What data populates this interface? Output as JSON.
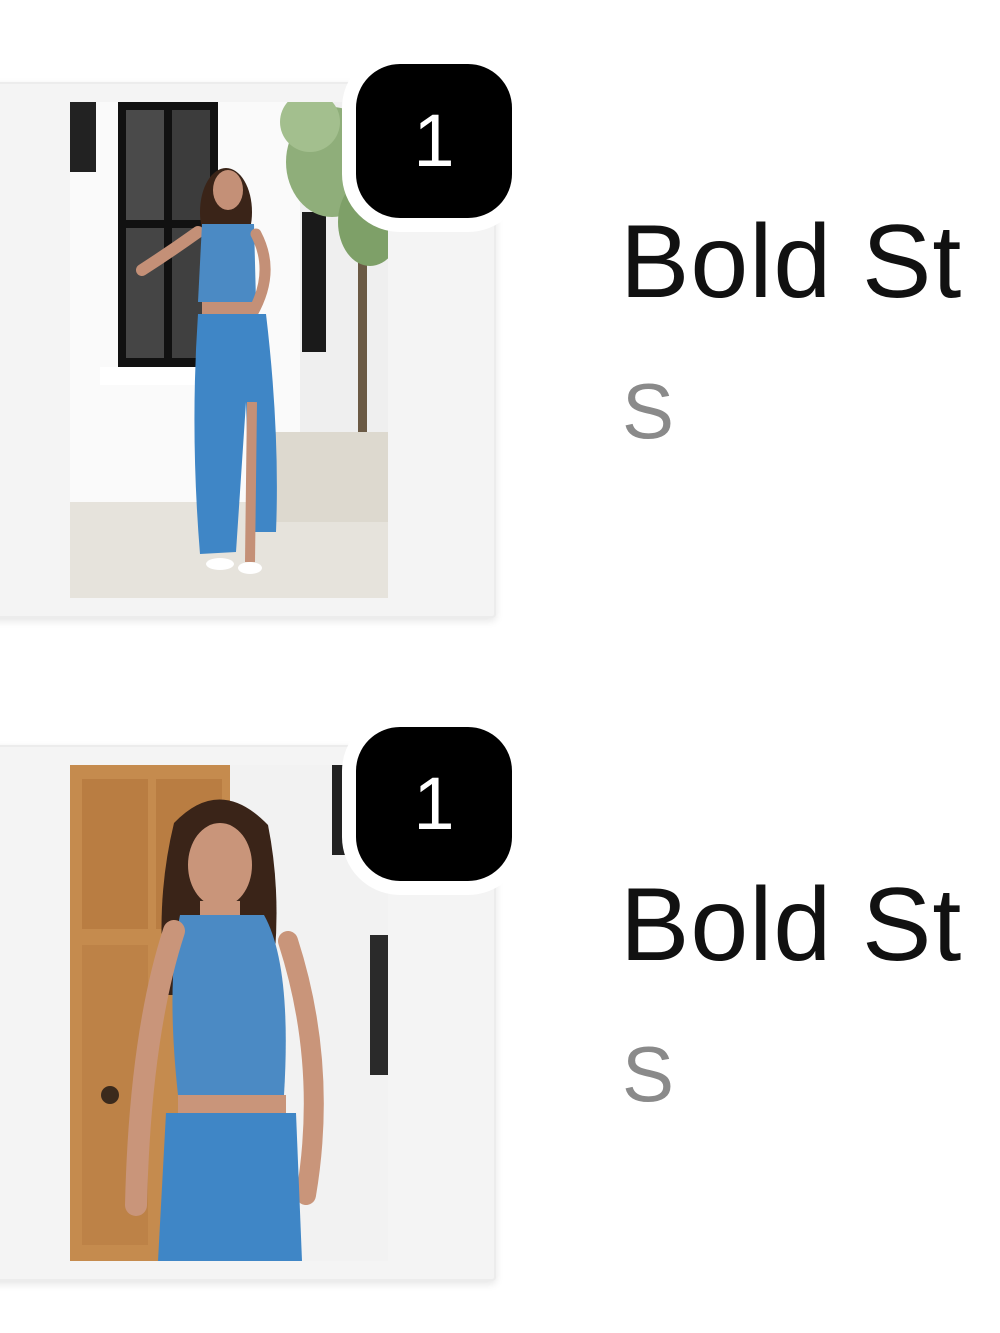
{
  "cart": {
    "items": [
      {
        "title": "Bold St",
        "variant": "S",
        "quantity": "1",
        "image_icon": "product-photo-full-length",
        "garment_color": "#3f86c6"
      },
      {
        "title": "Bold St",
        "variant": "S",
        "quantity": "1",
        "image_icon": "product-photo-half-length",
        "garment_color": "#3f86c6"
      }
    ]
  },
  "colors": {
    "badge_bg": "#000000",
    "badge_text": "#ffffff",
    "title_text": "#111111",
    "variant_text": "#8a8a8a"
  }
}
